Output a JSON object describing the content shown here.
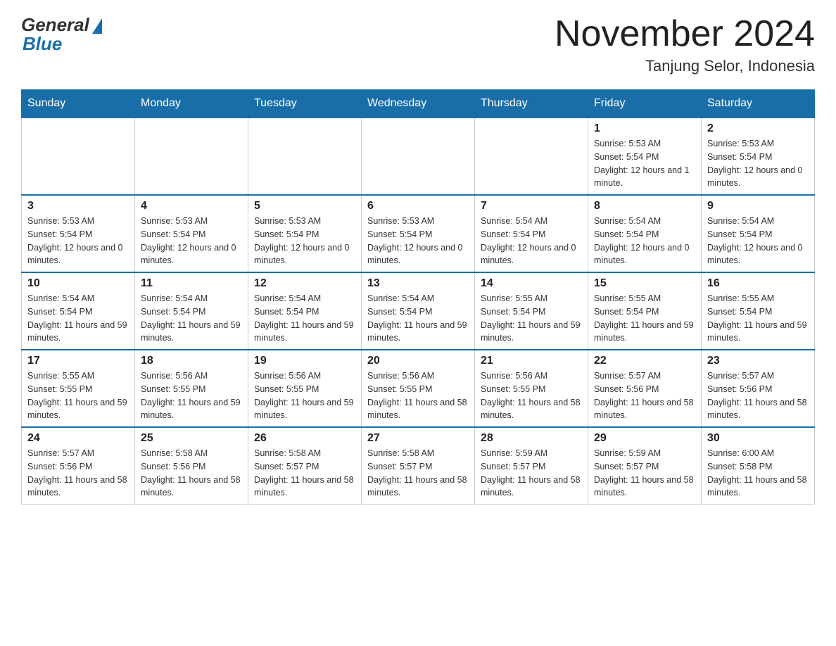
{
  "header": {
    "logo_general": "General",
    "logo_blue": "Blue",
    "month_title": "November 2024",
    "location": "Tanjung Selor, Indonesia"
  },
  "days_of_week": [
    "Sunday",
    "Monday",
    "Tuesday",
    "Wednesday",
    "Thursday",
    "Friday",
    "Saturday"
  ],
  "weeks": [
    [
      {
        "day": "",
        "info": ""
      },
      {
        "day": "",
        "info": ""
      },
      {
        "day": "",
        "info": ""
      },
      {
        "day": "",
        "info": ""
      },
      {
        "day": "",
        "info": ""
      },
      {
        "day": "1",
        "info": "Sunrise: 5:53 AM\nSunset: 5:54 PM\nDaylight: 12 hours and 1 minute."
      },
      {
        "day": "2",
        "info": "Sunrise: 5:53 AM\nSunset: 5:54 PM\nDaylight: 12 hours and 0 minutes."
      }
    ],
    [
      {
        "day": "3",
        "info": "Sunrise: 5:53 AM\nSunset: 5:54 PM\nDaylight: 12 hours and 0 minutes."
      },
      {
        "day": "4",
        "info": "Sunrise: 5:53 AM\nSunset: 5:54 PM\nDaylight: 12 hours and 0 minutes."
      },
      {
        "day": "5",
        "info": "Sunrise: 5:53 AM\nSunset: 5:54 PM\nDaylight: 12 hours and 0 minutes."
      },
      {
        "day": "6",
        "info": "Sunrise: 5:53 AM\nSunset: 5:54 PM\nDaylight: 12 hours and 0 minutes."
      },
      {
        "day": "7",
        "info": "Sunrise: 5:54 AM\nSunset: 5:54 PM\nDaylight: 12 hours and 0 minutes."
      },
      {
        "day": "8",
        "info": "Sunrise: 5:54 AM\nSunset: 5:54 PM\nDaylight: 12 hours and 0 minutes."
      },
      {
        "day": "9",
        "info": "Sunrise: 5:54 AM\nSunset: 5:54 PM\nDaylight: 12 hours and 0 minutes."
      }
    ],
    [
      {
        "day": "10",
        "info": "Sunrise: 5:54 AM\nSunset: 5:54 PM\nDaylight: 11 hours and 59 minutes."
      },
      {
        "day": "11",
        "info": "Sunrise: 5:54 AM\nSunset: 5:54 PM\nDaylight: 11 hours and 59 minutes."
      },
      {
        "day": "12",
        "info": "Sunrise: 5:54 AM\nSunset: 5:54 PM\nDaylight: 11 hours and 59 minutes."
      },
      {
        "day": "13",
        "info": "Sunrise: 5:54 AM\nSunset: 5:54 PM\nDaylight: 11 hours and 59 minutes."
      },
      {
        "day": "14",
        "info": "Sunrise: 5:55 AM\nSunset: 5:54 PM\nDaylight: 11 hours and 59 minutes."
      },
      {
        "day": "15",
        "info": "Sunrise: 5:55 AM\nSunset: 5:54 PM\nDaylight: 11 hours and 59 minutes."
      },
      {
        "day": "16",
        "info": "Sunrise: 5:55 AM\nSunset: 5:54 PM\nDaylight: 11 hours and 59 minutes."
      }
    ],
    [
      {
        "day": "17",
        "info": "Sunrise: 5:55 AM\nSunset: 5:55 PM\nDaylight: 11 hours and 59 minutes."
      },
      {
        "day": "18",
        "info": "Sunrise: 5:56 AM\nSunset: 5:55 PM\nDaylight: 11 hours and 59 minutes."
      },
      {
        "day": "19",
        "info": "Sunrise: 5:56 AM\nSunset: 5:55 PM\nDaylight: 11 hours and 59 minutes."
      },
      {
        "day": "20",
        "info": "Sunrise: 5:56 AM\nSunset: 5:55 PM\nDaylight: 11 hours and 58 minutes."
      },
      {
        "day": "21",
        "info": "Sunrise: 5:56 AM\nSunset: 5:55 PM\nDaylight: 11 hours and 58 minutes."
      },
      {
        "day": "22",
        "info": "Sunrise: 5:57 AM\nSunset: 5:56 PM\nDaylight: 11 hours and 58 minutes."
      },
      {
        "day": "23",
        "info": "Sunrise: 5:57 AM\nSunset: 5:56 PM\nDaylight: 11 hours and 58 minutes."
      }
    ],
    [
      {
        "day": "24",
        "info": "Sunrise: 5:57 AM\nSunset: 5:56 PM\nDaylight: 11 hours and 58 minutes."
      },
      {
        "day": "25",
        "info": "Sunrise: 5:58 AM\nSunset: 5:56 PM\nDaylight: 11 hours and 58 minutes."
      },
      {
        "day": "26",
        "info": "Sunrise: 5:58 AM\nSunset: 5:57 PM\nDaylight: 11 hours and 58 minutes."
      },
      {
        "day": "27",
        "info": "Sunrise: 5:58 AM\nSunset: 5:57 PM\nDaylight: 11 hours and 58 minutes."
      },
      {
        "day": "28",
        "info": "Sunrise: 5:59 AM\nSunset: 5:57 PM\nDaylight: 11 hours and 58 minutes."
      },
      {
        "day": "29",
        "info": "Sunrise: 5:59 AM\nSunset: 5:57 PM\nDaylight: 11 hours and 58 minutes."
      },
      {
        "day": "30",
        "info": "Sunrise: 6:00 AM\nSunset: 5:58 PM\nDaylight: 11 hours and 58 minutes."
      }
    ]
  ]
}
